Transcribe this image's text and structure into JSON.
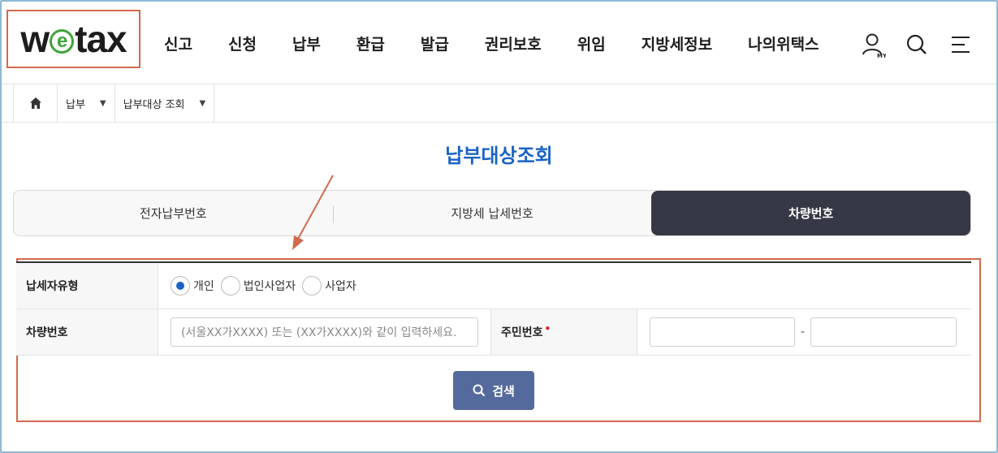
{
  "logo": {
    "part1": "w",
    "part2": "e",
    "part3": "tax"
  },
  "gnb": [
    "신고",
    "신청",
    "납부",
    "환급",
    "발급",
    "권리보호",
    "위임",
    "지방세정보",
    "나의위택스"
  ],
  "header_icons": {
    "my_label": "MY"
  },
  "breadcrumb": {
    "level1": "납부",
    "level2": "납부대상 조회"
  },
  "page_title": "납부대상조회",
  "tabs": [
    {
      "label": "전자납부번호",
      "active": false
    },
    {
      "label": "지방세 납세번호",
      "active": false
    },
    {
      "label": "차량번호",
      "active": true
    }
  ],
  "form": {
    "taxpayer_type_label": "납세자유형",
    "taxpayer_types": [
      {
        "label": "개인",
        "checked": true
      },
      {
        "label": "법인사업자",
        "checked": false
      },
      {
        "label": "사업자",
        "checked": false
      }
    ],
    "vehicle_label": "차량번호",
    "vehicle_placeholder": "(서울XX가XXXX) 또는 (XX가XXXX)와 같이 입력하세요.",
    "resident_label": "주민번호",
    "required_mark": "•",
    "resident_separator": "-"
  },
  "search_button": "검색",
  "colors": {
    "accent": "#1a63c6",
    "tab_active": "#363845",
    "button": "#546a9c",
    "annotation": "#d26a4c",
    "logo_green": "#3fa43a"
  }
}
